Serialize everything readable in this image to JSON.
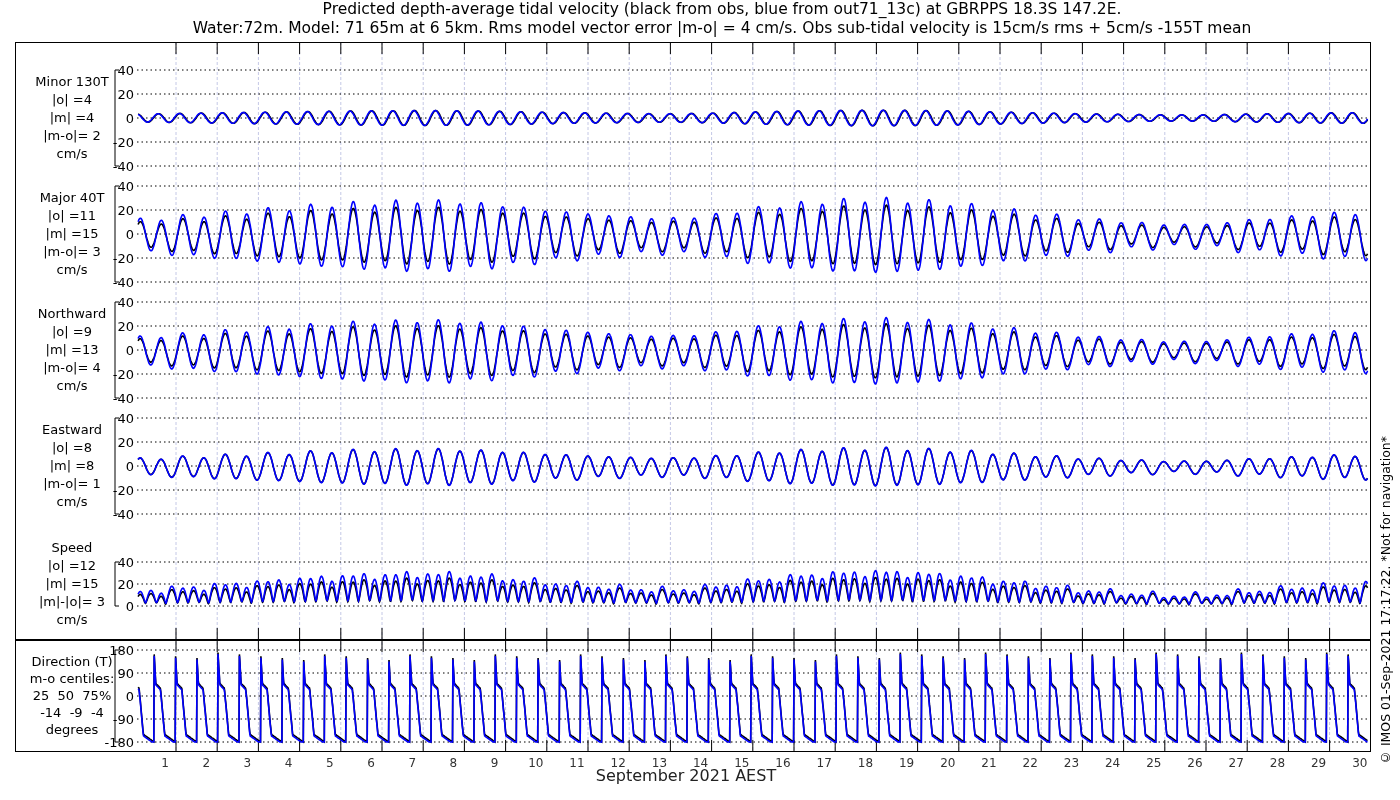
{
  "title": {
    "lines": [
      "Predicted depth-average tidal velocity (black from obs, blue from out71_13c) at GBRPPS 18.3S 147.2E.",
      "Water:72m. Model: 71 65m at 6 5km. Rms model vector error |m-o| = 4 cm/s. Obs sub-tidal velocity is 15cm/s rms + 5cm/s -155T mean"
    ]
  },
  "panels": [
    {
      "kind": "minor",
      "label_lines": [
        "Minor 130T",
        "|o| =4",
        "|m| =4",
        "|m-o|= 2",
        "cm/s"
      ],
      "yticks": [
        "40",
        "20",
        "0",
        "-20",
        "-40"
      ]
    },
    {
      "kind": "major",
      "label_lines": [
        "Major 40T",
        "|o| =11",
        "|m| =15",
        "|m-o|= 3",
        "cm/s"
      ],
      "yticks": [
        "40",
        "20",
        "0",
        "-20",
        "-40"
      ]
    },
    {
      "kind": "north",
      "label_lines": [
        "Northward",
        "|o| =9",
        "|m| =13",
        "|m-o|= 4",
        "cm/s"
      ],
      "yticks": [
        "40",
        "20",
        "0",
        "-20",
        "-40"
      ]
    },
    {
      "kind": "east",
      "label_lines": [
        "Eastward",
        "|o| =8",
        "|m| =8",
        "|m-o|= 1",
        "cm/s"
      ],
      "yticks": [
        "40",
        "20",
        "0",
        "-20",
        "-40"
      ]
    },
    {
      "kind": "speed",
      "label_lines": [
        "Speed",
        "|o| =12",
        "|m| =15",
        "|m|-|o|= 3",
        "cm/s"
      ],
      "yticks": [
        "40",
        "20",
        "0"
      ]
    },
    {
      "kind": "direction",
      "label_lines": [
        "Direction (T)",
        "m-o centiles:",
        "25  50  75%",
        "-14  -9  -4",
        "degrees"
      ],
      "yticks": [
        "180",
        "90",
        "0",
        "-90",
        "-180"
      ]
    }
  ],
  "days": [
    "1",
    "2",
    "3",
    "4",
    "5",
    "6",
    "7",
    "8",
    "9",
    "10",
    "11",
    "12",
    "13",
    "14",
    "15",
    "16",
    "17",
    "18",
    "19",
    "20",
    "21",
    "22",
    "23",
    "24",
    "25",
    "26",
    "27",
    "28",
    "29",
    "30"
  ],
  "xlabel": "September 2021 AEST",
  "credit": "© IMOS 01-Sep-2021 17:17:22. *Not for navigation*"
}
